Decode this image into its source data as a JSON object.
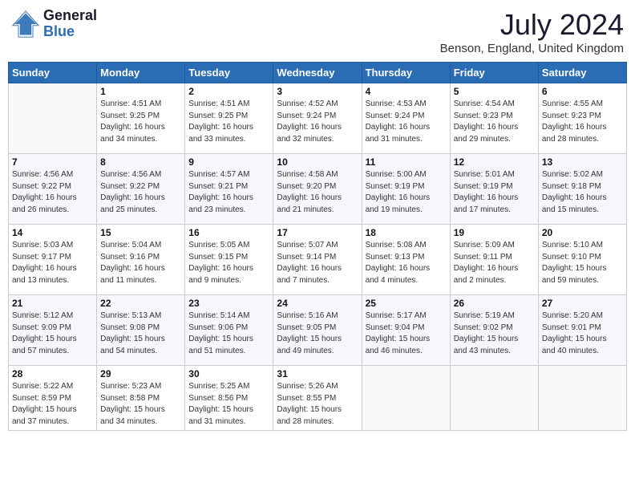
{
  "header": {
    "logo_general": "General",
    "logo_blue": "Blue",
    "month_year": "July 2024",
    "location": "Benson, England, United Kingdom"
  },
  "days_of_week": [
    "Sunday",
    "Monday",
    "Tuesday",
    "Wednesday",
    "Thursday",
    "Friday",
    "Saturday"
  ],
  "weeks": [
    [
      {
        "day": "",
        "info": ""
      },
      {
        "day": "1",
        "info": "Sunrise: 4:51 AM\nSunset: 9:25 PM\nDaylight: 16 hours\nand 34 minutes."
      },
      {
        "day": "2",
        "info": "Sunrise: 4:51 AM\nSunset: 9:25 PM\nDaylight: 16 hours\nand 33 minutes."
      },
      {
        "day": "3",
        "info": "Sunrise: 4:52 AM\nSunset: 9:24 PM\nDaylight: 16 hours\nand 32 minutes."
      },
      {
        "day": "4",
        "info": "Sunrise: 4:53 AM\nSunset: 9:24 PM\nDaylight: 16 hours\nand 31 minutes."
      },
      {
        "day": "5",
        "info": "Sunrise: 4:54 AM\nSunset: 9:23 PM\nDaylight: 16 hours\nand 29 minutes."
      },
      {
        "day": "6",
        "info": "Sunrise: 4:55 AM\nSunset: 9:23 PM\nDaylight: 16 hours\nand 28 minutes."
      }
    ],
    [
      {
        "day": "7",
        "info": "Sunrise: 4:56 AM\nSunset: 9:22 PM\nDaylight: 16 hours\nand 26 minutes."
      },
      {
        "day": "8",
        "info": "Sunrise: 4:56 AM\nSunset: 9:22 PM\nDaylight: 16 hours\nand 25 minutes."
      },
      {
        "day": "9",
        "info": "Sunrise: 4:57 AM\nSunset: 9:21 PM\nDaylight: 16 hours\nand 23 minutes."
      },
      {
        "day": "10",
        "info": "Sunrise: 4:58 AM\nSunset: 9:20 PM\nDaylight: 16 hours\nand 21 minutes."
      },
      {
        "day": "11",
        "info": "Sunrise: 5:00 AM\nSunset: 9:19 PM\nDaylight: 16 hours\nand 19 minutes."
      },
      {
        "day": "12",
        "info": "Sunrise: 5:01 AM\nSunset: 9:19 PM\nDaylight: 16 hours\nand 17 minutes."
      },
      {
        "day": "13",
        "info": "Sunrise: 5:02 AM\nSunset: 9:18 PM\nDaylight: 16 hours\nand 15 minutes."
      }
    ],
    [
      {
        "day": "14",
        "info": "Sunrise: 5:03 AM\nSunset: 9:17 PM\nDaylight: 16 hours\nand 13 minutes."
      },
      {
        "day": "15",
        "info": "Sunrise: 5:04 AM\nSunset: 9:16 PM\nDaylight: 16 hours\nand 11 minutes."
      },
      {
        "day": "16",
        "info": "Sunrise: 5:05 AM\nSunset: 9:15 PM\nDaylight: 16 hours\nand 9 minutes."
      },
      {
        "day": "17",
        "info": "Sunrise: 5:07 AM\nSunset: 9:14 PM\nDaylight: 16 hours\nand 7 minutes."
      },
      {
        "day": "18",
        "info": "Sunrise: 5:08 AM\nSunset: 9:13 PM\nDaylight: 16 hours\nand 4 minutes."
      },
      {
        "day": "19",
        "info": "Sunrise: 5:09 AM\nSunset: 9:11 PM\nDaylight: 16 hours\nand 2 minutes."
      },
      {
        "day": "20",
        "info": "Sunrise: 5:10 AM\nSunset: 9:10 PM\nDaylight: 15 hours\nand 59 minutes."
      }
    ],
    [
      {
        "day": "21",
        "info": "Sunrise: 5:12 AM\nSunset: 9:09 PM\nDaylight: 15 hours\nand 57 minutes."
      },
      {
        "day": "22",
        "info": "Sunrise: 5:13 AM\nSunset: 9:08 PM\nDaylight: 15 hours\nand 54 minutes."
      },
      {
        "day": "23",
        "info": "Sunrise: 5:14 AM\nSunset: 9:06 PM\nDaylight: 15 hours\nand 51 minutes."
      },
      {
        "day": "24",
        "info": "Sunrise: 5:16 AM\nSunset: 9:05 PM\nDaylight: 15 hours\nand 49 minutes."
      },
      {
        "day": "25",
        "info": "Sunrise: 5:17 AM\nSunset: 9:04 PM\nDaylight: 15 hours\nand 46 minutes."
      },
      {
        "day": "26",
        "info": "Sunrise: 5:19 AM\nSunset: 9:02 PM\nDaylight: 15 hours\nand 43 minutes."
      },
      {
        "day": "27",
        "info": "Sunrise: 5:20 AM\nSunset: 9:01 PM\nDaylight: 15 hours\nand 40 minutes."
      }
    ],
    [
      {
        "day": "28",
        "info": "Sunrise: 5:22 AM\nSunset: 8:59 PM\nDaylight: 15 hours\nand 37 minutes."
      },
      {
        "day": "29",
        "info": "Sunrise: 5:23 AM\nSunset: 8:58 PM\nDaylight: 15 hours\nand 34 minutes."
      },
      {
        "day": "30",
        "info": "Sunrise: 5:25 AM\nSunset: 8:56 PM\nDaylight: 15 hours\nand 31 minutes."
      },
      {
        "day": "31",
        "info": "Sunrise: 5:26 AM\nSunset: 8:55 PM\nDaylight: 15 hours\nand 28 minutes."
      },
      {
        "day": "",
        "info": ""
      },
      {
        "day": "",
        "info": ""
      },
      {
        "day": "",
        "info": ""
      }
    ]
  ]
}
